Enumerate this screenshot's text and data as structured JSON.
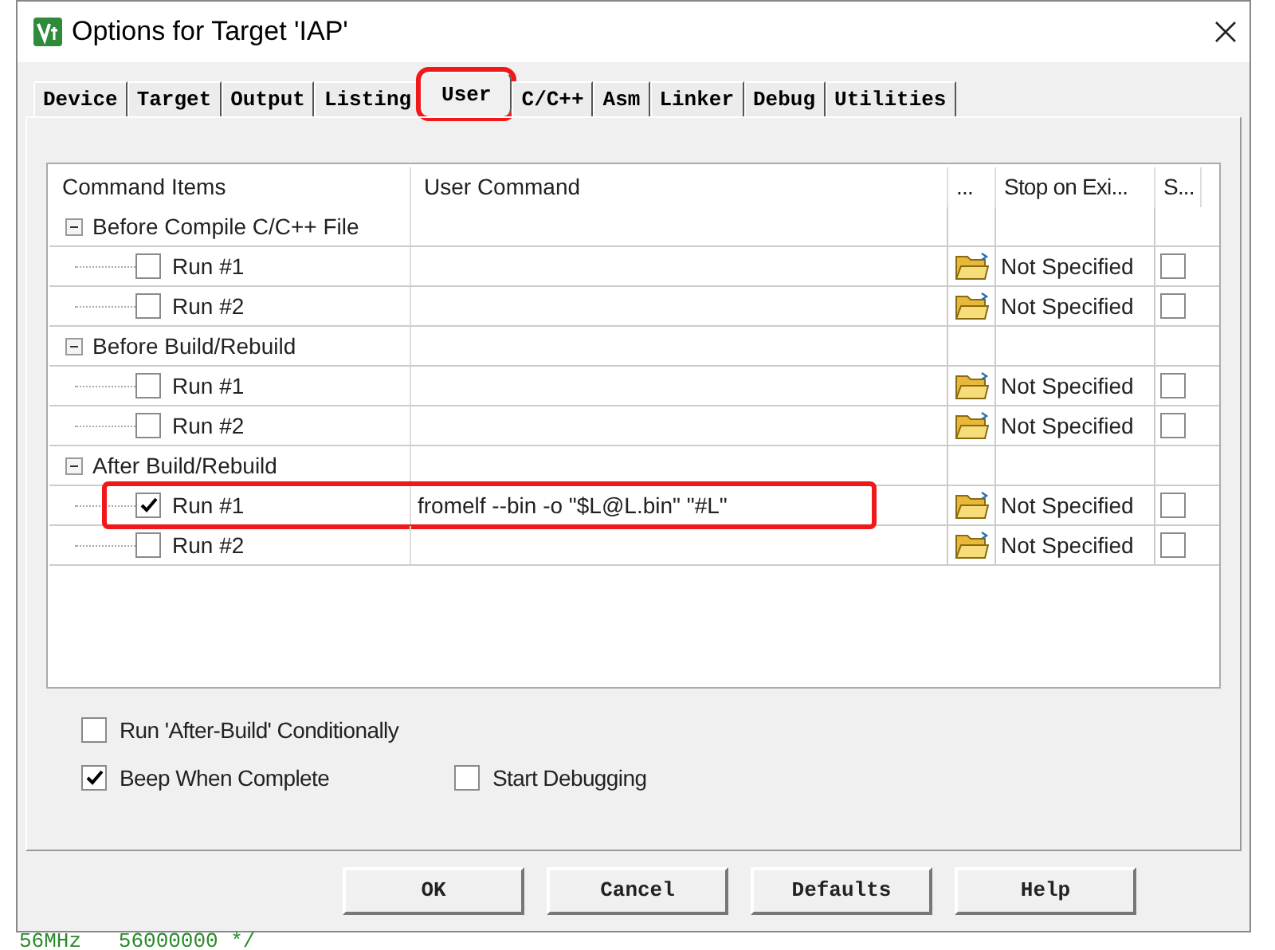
{
  "window": {
    "title": "Options for Target 'IAP'"
  },
  "tabs": [
    {
      "label": "Device",
      "selected": false,
      "highlighted": false
    },
    {
      "label": "Target",
      "selected": false,
      "highlighted": false
    },
    {
      "label": "Output",
      "selected": false,
      "highlighted": false
    },
    {
      "label": "Listing",
      "selected": false,
      "highlighted": false
    },
    {
      "label": "User",
      "selected": true,
      "highlighted": true
    },
    {
      "label": "C/C++",
      "selected": false,
      "highlighted": false
    },
    {
      "label": "Asm",
      "selected": false,
      "highlighted": false
    },
    {
      "label": "Linker",
      "selected": false,
      "highlighted": false
    },
    {
      "label": "Debug",
      "selected": false,
      "highlighted": false
    },
    {
      "label": "Utilities",
      "selected": false,
      "highlighted": false
    }
  ],
  "table": {
    "columns": [
      "Command Items",
      "User Command",
      "...",
      "Stop on Exi...",
      "S..."
    ],
    "groups": [
      {
        "label": "Before Compile C/C++ File",
        "expanded": true,
        "children": [
          {
            "label": "Run #1",
            "checked": false,
            "stop": "Not Specified",
            "stop_checked": false,
            "highlighted": false
          },
          {
            "label": "Run #2",
            "checked": false,
            "stop": "Not Specified",
            "stop_checked": false,
            "highlighted": false
          }
        ]
      },
      {
        "label": "Before Build/Rebuild",
        "expanded": true,
        "children": [
          {
            "label": "Run #1",
            "checked": false,
            "stop": "Not Specified",
            "stop_checked": false,
            "highlighted": false
          },
          {
            "label": "Run #2",
            "checked": false,
            "stop": "Not Specified",
            "stop_checked": false,
            "highlighted": false
          }
        ]
      },
      {
        "label": "After Build/Rebuild",
        "expanded": true,
        "children": [
          {
            "label": "Run #1",
            "checked": true,
            "command": "fromelf --bin -o \"$L@L.bin\" \"#L\"",
            "stop": "Not Specified",
            "stop_checked": false,
            "highlighted": true
          },
          {
            "label": "Run #2",
            "checked": false,
            "stop": "Not Specified",
            "stop_checked": false,
            "highlighted": false
          }
        ]
      }
    ]
  },
  "options": [
    {
      "label": "Run 'After-Build' Conditionally",
      "checked": false
    },
    {
      "label": "Beep When Complete",
      "checked": true
    },
    {
      "label": "Start Debugging",
      "checked": false
    }
  ],
  "buttons": [
    "OK",
    "Cancel",
    "Defaults",
    "Help"
  ],
  "editor_line": "56MHz   56000000 */"
}
